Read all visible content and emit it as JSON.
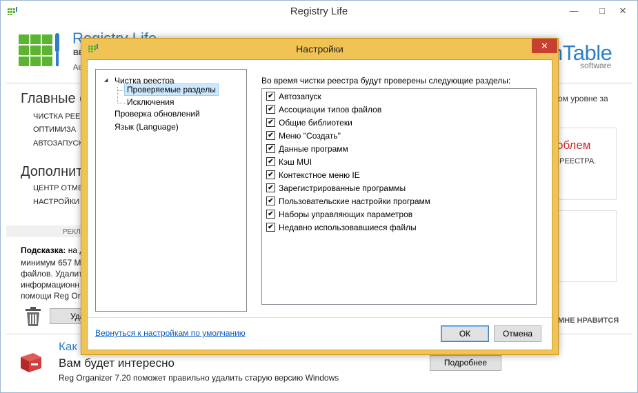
{
  "main_window": {
    "title": "Registry Life",
    "controls": {
      "minimize": "—",
      "maximize": "□",
      "close": "✕"
    },
    "header": {
      "app_name": "Registry Life",
      "version": "ВЕ",
      "author": "Ав",
      "brand_name": "nTable",
      "brand_sub": "software"
    },
    "main_functions": {
      "heading": "Главные с",
      "links": [
        "ЧИСТКА РЕЕСТ",
        "ОПТИМИЗА",
        "АВТОЗАПУСК"
      ]
    },
    "additional": {
      "heading": "Дополнит",
      "links": [
        "ЦЕНТР ОТМЕН",
        "НАСТРОЙКИ"
      ]
    },
    "right_panel": {
      "level_text": "ом уровне за",
      "day_text": "",
      "problems": "облем",
      "registry": "РЕЕСТРА.",
      "dislike": "МНЕ НРАВИТСЯ"
    },
    "ad_label": "РЕКЛ",
    "tip": {
      "prefix": "Подсказка:",
      "line1_rest": " на д",
      "line2": "минимум 657 М",
      "line3": "файлов. Удалит",
      "line4": "информационн",
      "line5": "помощи Reg Or"
    },
    "delete_button": "Уда",
    "promo": {
      "how": "Как",
      "interesting": "Вам будет интересно",
      "description": "Reg Organizer 7.20 поможет правильно удалить старую версию Windows",
      "more_button": "Подробнее"
    }
  },
  "settings_dialog": {
    "title": "Настройки",
    "close": "✕",
    "tree": {
      "toggle": "◢",
      "clean": "Чистка реестра",
      "checked_sections": "Проверяемые разделы",
      "exclusions": "Исключения",
      "updates": "Проверка обновлений",
      "language": "Язык (Language)"
    },
    "intro": "Во время чистки реестра будут проверены следующие разделы:",
    "sections": [
      {
        "label": "Автозапуск",
        "checked": true
      },
      {
        "label": "Ассоциации типов файлов",
        "checked": true
      },
      {
        "label": "Общие библиотеки",
        "checked": true
      },
      {
        "label": "Меню \"Создать\"",
        "checked": true
      },
      {
        "label": "Данные программ",
        "checked": true
      },
      {
        "label": "Кэш MUI",
        "checked": true
      },
      {
        "label": "Контекстное меню IE",
        "checked": true
      },
      {
        "label": "Зарегистрированные программы",
        "checked": true
      },
      {
        "label": "Пользовательские настройки программ",
        "checked": true
      },
      {
        "label": "Наборы управляющих параметров",
        "checked": true
      },
      {
        "label": "Недавно использовавшиеся файлы",
        "checked": true
      }
    ],
    "check_glyph": "✔",
    "restore_defaults": "Вернуться к настройкам по умолчанию",
    "ok_button": "ОК",
    "cancel_button": "Отмена"
  },
  "colors": {
    "accent_blue": "#2c7fc8",
    "logo_green": "#5cb531",
    "dialog_frame": "#f0c354",
    "close_red": "#c7402f",
    "problem_red": "#d12727"
  }
}
